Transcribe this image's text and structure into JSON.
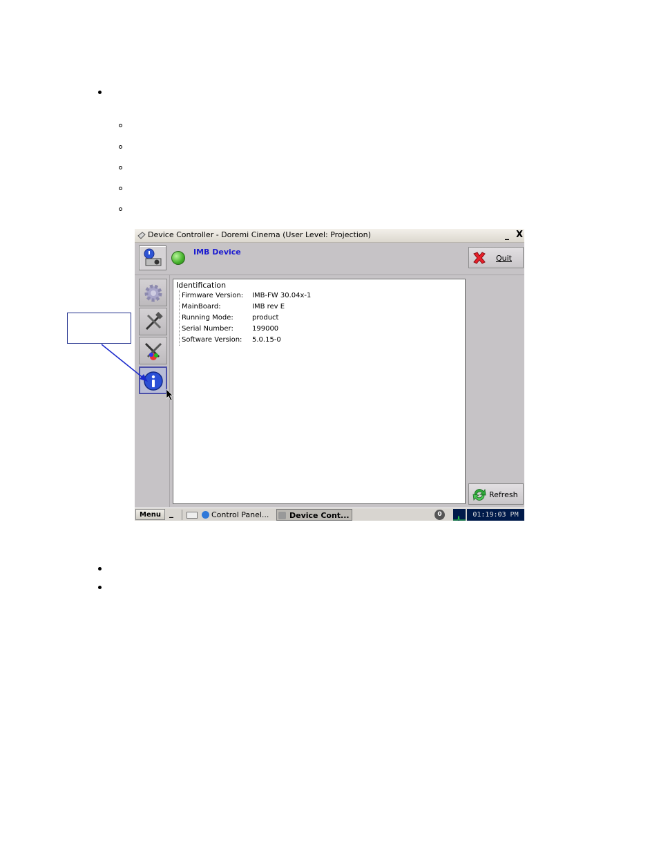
{
  "window": {
    "title": "Device Controller - Doremi Cinema (User Level: Projection)",
    "minimize_glyph": "_",
    "close_glyph": "X"
  },
  "toolbar": {
    "device_name": "IMB Device",
    "quit_label": "Quit",
    "status_color": "#43b02a"
  },
  "sidebar": {
    "items": [
      {
        "name": "gear-icon"
      },
      {
        "name": "tools-icon"
      },
      {
        "name": "color-tools-icon"
      },
      {
        "name": "info-icon"
      }
    ]
  },
  "identification": {
    "root": "Identification",
    "rows": [
      {
        "key": "Firmware Version:",
        "value": "IMB-FW  30.04x-1"
      },
      {
        "key": "MainBoard:",
        "value": "IMB rev E"
      },
      {
        "key": "Running Mode:",
        "value": "product"
      },
      {
        "key": "Serial Number:",
        "value": "199000"
      },
      {
        "key": "Software Version:",
        "value": "5.0.15-0"
      }
    ]
  },
  "refresh_label": "Refresh",
  "taskbar": {
    "menu_label": "Menu",
    "min_glyph": "_",
    "control_panel": "Control Panel...",
    "device_cont": "Device Cont...",
    "tray_badge": "0",
    "clock": "01:19:03 PM"
  },
  "colors": {
    "accent_link": "#1b1bd0",
    "callout_arrow": "#1b2acc"
  }
}
